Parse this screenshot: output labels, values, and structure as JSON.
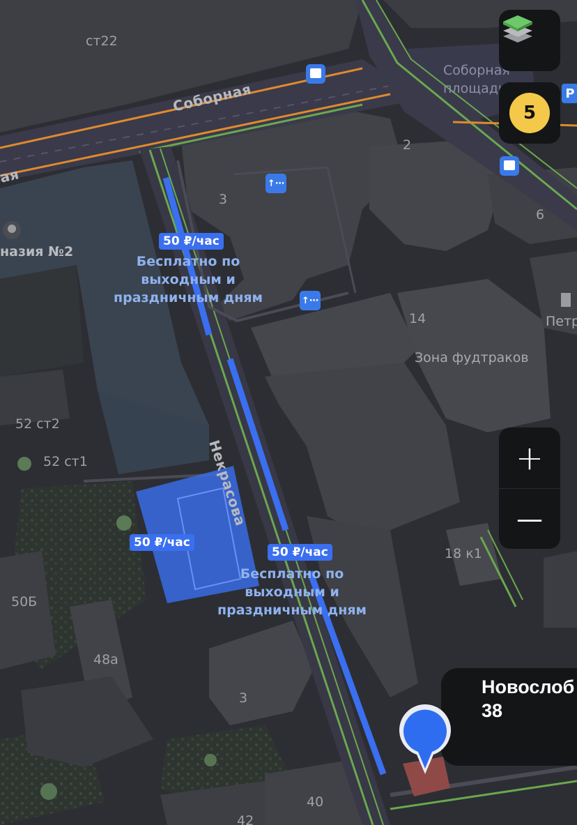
{
  "map": {
    "street_labels": {
      "sobornaya": "Соборная",
      "sobornaya_left": "ая",
      "nekrasova": "Некрасова"
    },
    "square_label": "Соборная\nплощадь",
    "building_numbers": {
      "st22": "ст22",
      "b2": "2",
      "b3_top": "3",
      "b6": "6",
      "b14": "14",
      "b52st2": "52 ст2",
      "b52st1": "52 ст1",
      "b50b": "50Б",
      "b48a": "48а",
      "b3_bottom": "3",
      "b18k1": "18 к1",
      "b40": "40",
      "b42": "42"
    },
    "poi_labels": {
      "gymnasium": "назия №2",
      "food_trucks": "Зона фудтраков",
      "petr": "Петр"
    },
    "parking": {
      "price": "50 ₽/час",
      "note": "Бесплатно по\nвыходным и\nпраздничным дням",
      "lot_price": "50 ₽/час"
    },
    "layers_icon": "layers-stack-icon",
    "transport_badge": "5",
    "zoom_in": "+",
    "zoom_out": "—",
    "location_callout": {
      "line1": "Новослоб",
      "line2": "38"
    },
    "parking_sign": "P",
    "colors": {
      "background": "#2b2d31",
      "building": "#3d3f44",
      "road": "#3a3a4a",
      "parking_blue": "#3a6ff0",
      "traffic_green": "#6aa84f",
      "traffic_orange": "#e08a2e",
      "pin_blue": "#2f6df0",
      "badge_yellow": "#f4c94a"
    }
  }
}
